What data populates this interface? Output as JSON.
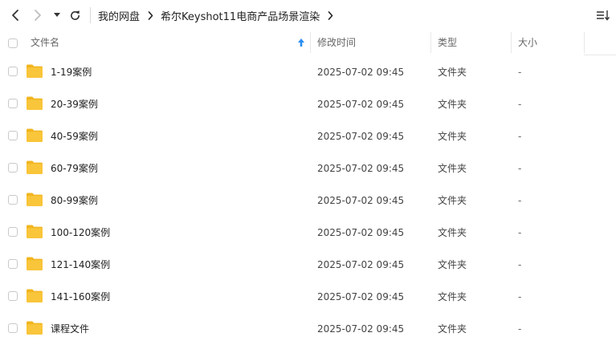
{
  "toolbar": {
    "breadcrumbs": [
      "我的网盘",
      "希尔Keyshot11电商产品场景渲染"
    ]
  },
  "table": {
    "headers": {
      "name": "文件名",
      "modified": "修改时间",
      "type": "类型",
      "size": "大小"
    },
    "rows": [
      {
        "name": "1-19案例",
        "modified": "2025-07-02 09:45",
        "type": "文件夹",
        "size": "-"
      },
      {
        "name": "20-39案例",
        "modified": "2025-07-02 09:45",
        "type": "文件夹",
        "size": "-"
      },
      {
        "name": "40-59案例",
        "modified": "2025-07-02 09:45",
        "type": "文件夹",
        "size": "-"
      },
      {
        "name": "60-79案例",
        "modified": "2025-07-02 09:45",
        "type": "文件夹",
        "size": "-"
      },
      {
        "name": "80-99案例",
        "modified": "2025-07-02 09:45",
        "type": "文件夹",
        "size": "-"
      },
      {
        "name": "100-120案例",
        "modified": "2025-07-02 09:45",
        "type": "文件夹",
        "size": "-"
      },
      {
        "name": "121-140案例",
        "modified": "2025-07-02 09:45",
        "type": "文件夹",
        "size": "-"
      },
      {
        "name": "141-160案例",
        "modified": "2025-07-02 09:45",
        "type": "文件夹",
        "size": "-"
      },
      {
        "name": "课程文件",
        "modified": "2025-07-02 09:45",
        "type": "文件夹",
        "size": "-"
      }
    ]
  },
  "colors": {
    "folder": "#f9c53a",
    "folder_dark": "#f2b51f",
    "accent": "#2a8cf2"
  },
  "icons": {
    "back": "chevron-left-icon",
    "forward": "chevron-right-icon",
    "history": "caret-down-icon",
    "refresh": "refresh-icon",
    "crumb_separator": "chevron-right-icon",
    "sort_menu": "sort-list-icon",
    "sort_direction": "arrow-up-icon",
    "row": "folder-icon"
  }
}
